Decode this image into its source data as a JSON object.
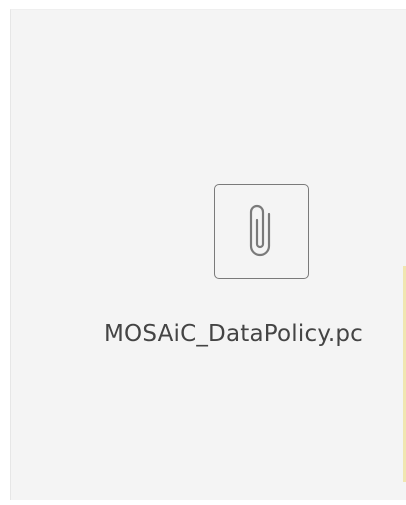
{
  "attachment": {
    "file_name": "MOSAiC_DataPolicy.pc",
    "icon": "paperclip-icon"
  },
  "colors": {
    "panel_background": "#f4f4f4",
    "icon_stroke": "#7a7a7a",
    "text": "#444444"
  }
}
